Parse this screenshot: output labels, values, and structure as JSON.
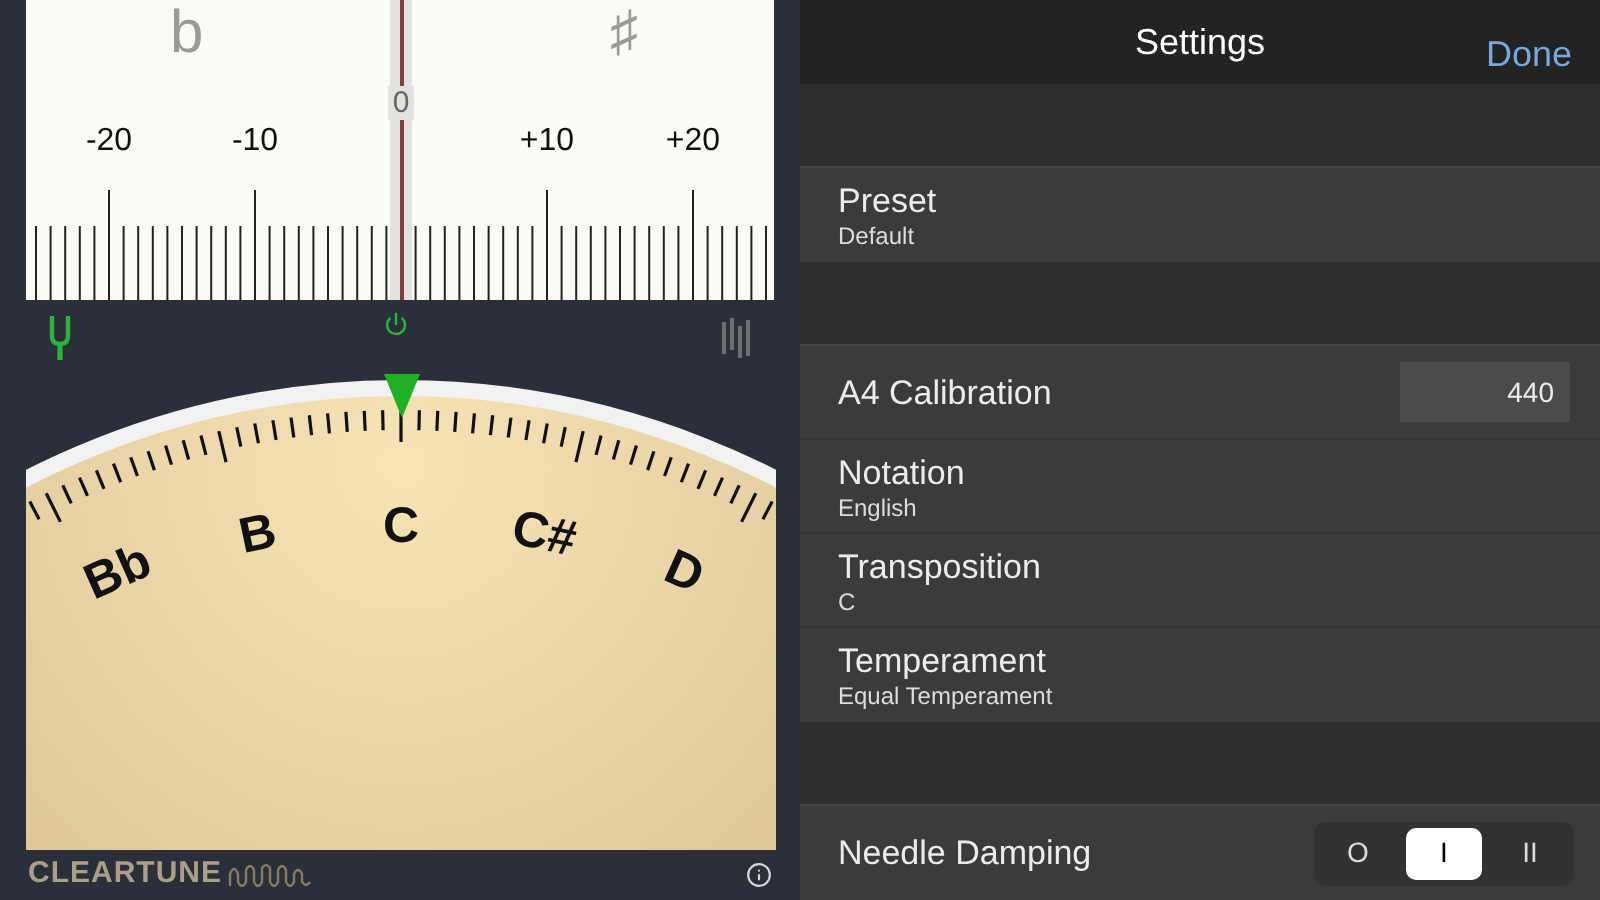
{
  "tuner": {
    "strobe": {
      "flat_sign": "b",
      "sharp_sign": "♯",
      "center_label": "0",
      "scale_labels": [
        "-20",
        "-10",
        "+10",
        "+20"
      ]
    },
    "dial": {
      "notes": [
        "Bb",
        "B",
        "C",
        "C#",
        "D"
      ]
    },
    "logo": "CLEARTUNE"
  },
  "settings": {
    "title": "Settings",
    "done": "Done",
    "groups": [
      {
        "rows": [
          {
            "kind": "detail",
            "label": "Preset",
            "value": "Default"
          }
        ]
      },
      {
        "rows": [
          {
            "kind": "field",
            "label": "A4 Calibration",
            "value": "440"
          },
          {
            "kind": "detail",
            "label": "Notation",
            "value": "English"
          },
          {
            "kind": "detail",
            "label": "Transposition",
            "value": "C"
          },
          {
            "kind": "detail",
            "label": "Temperament",
            "value": "Equal Temperament"
          }
        ]
      },
      {
        "rows": [
          {
            "kind": "segmented",
            "label": "Needle Damping",
            "options": [
              {
                "label": "O",
                "selected": false
              },
              {
                "label": "I",
                "selected": true
              },
              {
                "label": "II",
                "selected": false
              }
            ]
          }
        ]
      }
    ]
  }
}
